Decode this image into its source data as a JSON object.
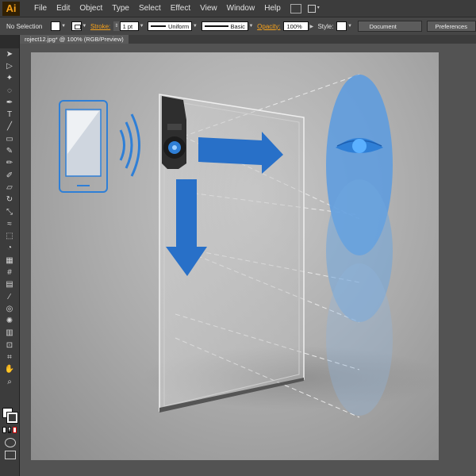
{
  "app": {
    "logo": "Ai",
    "menu": [
      "File",
      "Edit",
      "Object",
      "Type",
      "Select",
      "Effect",
      "View",
      "Window",
      "Help"
    ]
  },
  "control_bar": {
    "selection": "No Selection",
    "stroke_label": "Stroke:",
    "stroke_weight": "1 pt",
    "profile": "Uniform",
    "brush": "Basic",
    "opacity_label": "Opacity:",
    "opacity_value": "100%",
    "style_label": "Style:",
    "document_setup": "Document Setup",
    "preferences": "Preferences"
  },
  "document": {
    "tab_title": "roject12.jpg* @ 100% (RGB/Preview)"
  },
  "tools": [
    "selection-icon",
    "direct-selection-icon",
    "magic-wand-icon",
    "lasso-icon",
    "pen-icon",
    "type-icon",
    "line-segment-icon",
    "rectangle-icon",
    "paintbrush-icon",
    "pencil-icon",
    "blob-brush-icon",
    "eraser-icon",
    "rotate-icon",
    "scale-icon",
    "warp-icon",
    "free-transform-icon",
    "shape-builder-icon",
    "perspective-grid-icon",
    "mesh-icon",
    "gradient-icon",
    "eyedropper-icon",
    "blend-icon",
    "symbol-sprayer-icon",
    "column-graph-icon",
    "artboard-icon",
    "slice-icon",
    "hand-icon",
    "zoom-icon"
  ],
  "colors": {
    "accent_orange": "#f7a21b",
    "illustration_blue": "#2f7fd6",
    "ellipse_blue": "#5b9be0"
  }
}
